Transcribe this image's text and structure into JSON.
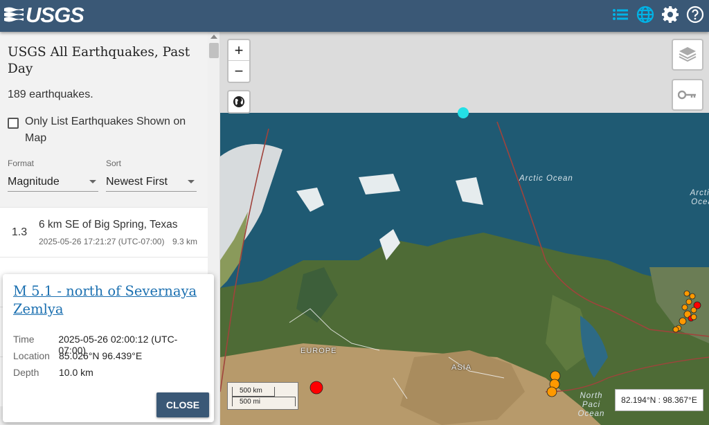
{
  "header": {
    "logo_text": "USGS",
    "icons": [
      "list-icon",
      "globe-icon",
      "gear-icon",
      "help-icon"
    ],
    "accent_color": "#00b3e6",
    "bar_color": "#3a5876"
  },
  "sidebar": {
    "title": "USGS All Earthquakes, Past Day",
    "count_text": "189 earthquakes.",
    "filter_label": "Only List Earthquakes Shown on Map",
    "format_label": "Format",
    "format_value": "Magnitude",
    "sort_label": "Sort",
    "sort_value": "Newest First",
    "quakes": [
      {
        "mag": "1.3",
        "place": "6 km SE of Big Spring, Texas",
        "time": "2025-05-26 17:21:27 (UTC-07:00)",
        "depth": "9.3 km"
      }
    ]
  },
  "map": {
    "zoom_in": "+",
    "zoom_out": "−",
    "scale_km": "500 km",
    "scale_mi": "500 mi",
    "coords": "82.194°N : 98.367°E",
    "labels": {
      "arctic_ocean": "Arctic Ocean",
      "arctic_ocean_right": "Arctic Ocea",
      "europe": "EUROPE",
      "asia": "ASIA",
      "north_pacific": "North Paci Ocean"
    }
  },
  "popup": {
    "title": "M 5.1 - north of Severnaya Zemlya",
    "rows": [
      {
        "key": "Time",
        "value": "2025-05-26 02:00:12 (UTC-07:00)"
      },
      {
        "key": "Location",
        "value": "85.026°N 96.439°E"
      },
      {
        "key": "Depth",
        "value": "10.0 km"
      }
    ],
    "close_label": "CLOSE"
  }
}
